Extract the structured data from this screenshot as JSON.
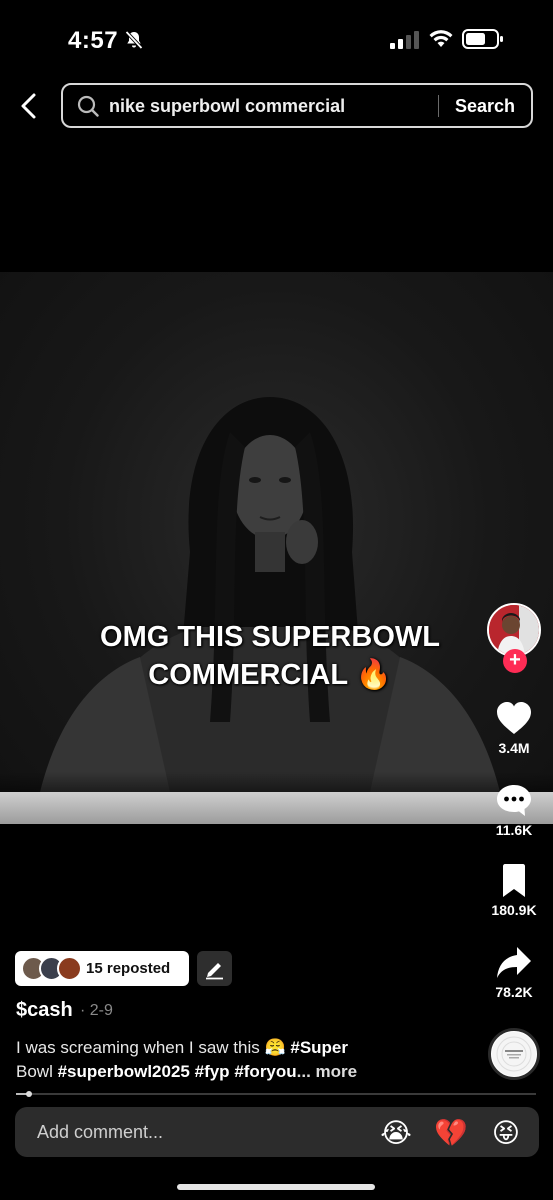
{
  "status_bar": {
    "time": "4:57",
    "silent_icon": "bell-slash-icon",
    "signal_icon": "cellular-signal-icon",
    "wifi_icon": "wifi-icon",
    "battery_icon": "battery-icon"
  },
  "search": {
    "query": "nike superbowl commercial",
    "button_label": "Search",
    "back_icon": "chevron-left-icon",
    "search_icon": "magnifier-icon"
  },
  "video": {
    "caption_line1": "OMG THIS SUPERBOWL",
    "caption_line2": "COMMERCIAL 🔥"
  },
  "rail": {
    "likes": "3.4M",
    "comments": "11.6K",
    "saves": "180.9K",
    "shares": "78.2K",
    "follow_icon": "plus-icon"
  },
  "post": {
    "repost_label": "15 reposted",
    "username": "$cash",
    "date": "· 2-9",
    "desc_prefix": "I was screaming when I saw this 😤 ",
    "tag1a": "#Super",
    "tag1b": "Bowl",
    "tag2": "#superbowl2025",
    "tag3": "#fyp",
    "tag4": "#foryou",
    "more": "... more"
  },
  "playback": {
    "progress": 0.025
  },
  "comment_bar": {
    "placeholder": "Add comment...",
    "emoji1": "😭",
    "emoji2": "💔",
    "emoji3": "😝"
  },
  "colors": {
    "accent": "#fe2c55",
    "background": "#000000",
    "comment_bar": "#2c2c2c"
  }
}
